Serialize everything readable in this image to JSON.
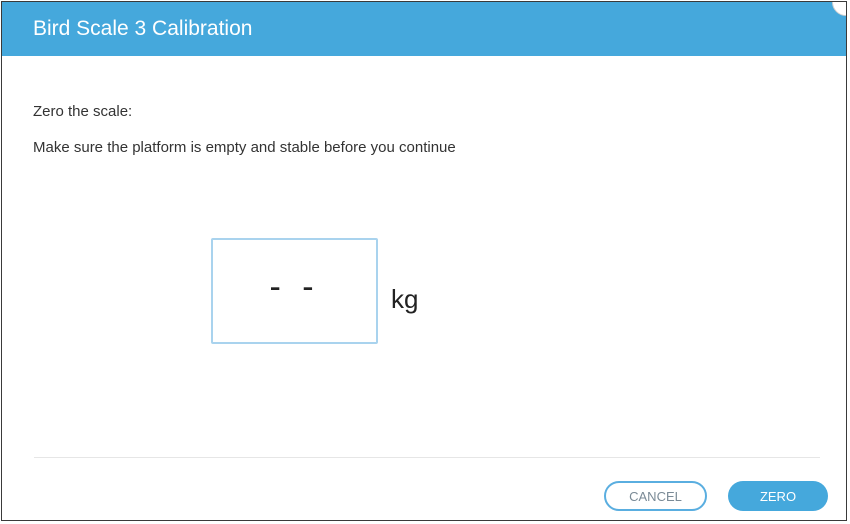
{
  "dialog": {
    "title": "Bird Scale 3 Calibration",
    "heading": "Zero the scale:",
    "instruction": "Make sure the platform is empty and stable before you continue",
    "weight_value": "- -",
    "weight_unit": "kg",
    "cancel_label": "CANCEL",
    "zero_label": "ZERO"
  },
  "colors": {
    "accent": "#45a8dc",
    "box_border": "#a9d3ee"
  }
}
